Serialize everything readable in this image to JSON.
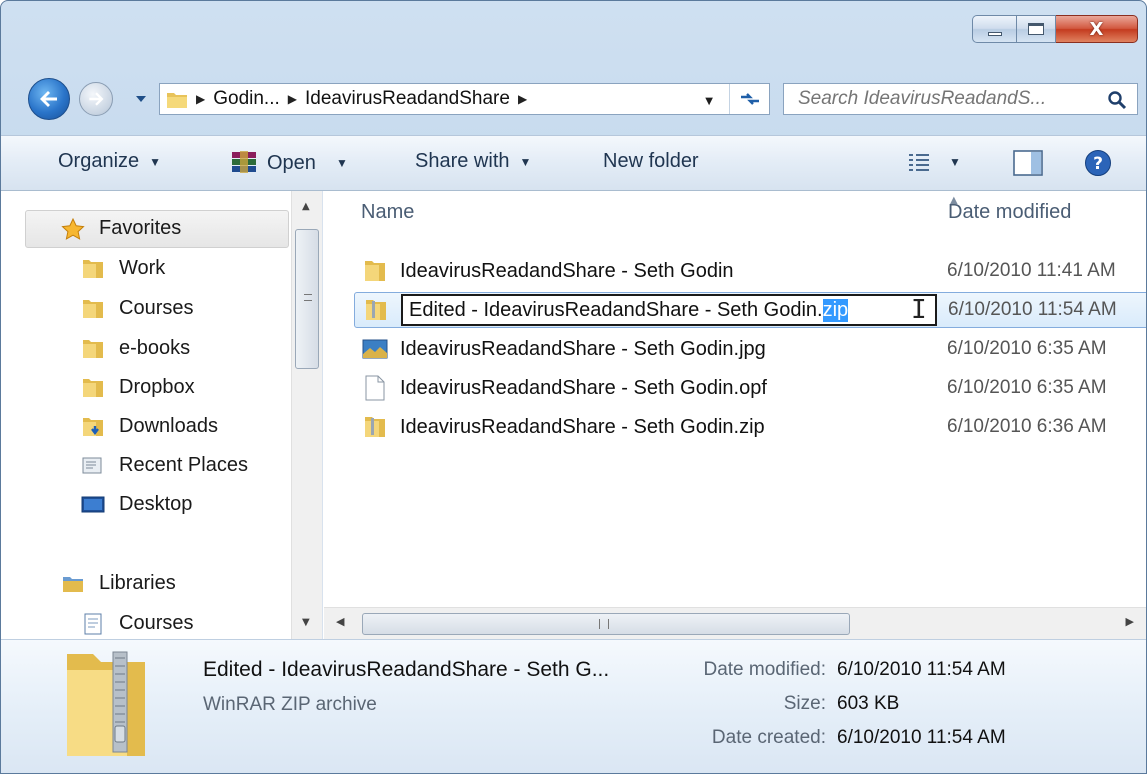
{
  "window": {
    "close_glyph": "X"
  },
  "address_bar": {
    "crumbs": [
      "Godin...",
      "IdeavirusReadandShare"
    ]
  },
  "search": {
    "placeholder": "Search IdeavirusReadandS..."
  },
  "toolbar": {
    "organize": "Organize",
    "open": "Open",
    "share_with": "Share with",
    "new_folder": "New folder"
  },
  "nav_pane": {
    "favorites": "Favorites",
    "items": [
      "Work",
      "Courses",
      "e-books",
      "Dropbox",
      "Downloads",
      "Recent Places",
      "Desktop"
    ],
    "libraries": "Libraries",
    "library_items": [
      "Courses"
    ]
  },
  "file_list": {
    "columns": {
      "name": "Name",
      "date_modified": "Date modified"
    },
    "rows": [
      {
        "name": "IdeavirusReadandShare - Seth Godin",
        "date": "6/10/2010 11:41 AM",
        "icon": "folder-icon"
      },
      {
        "name": "Edited - IdeavirusReadandShare - Seth Godin.",
        "name_selected": "zip",
        "date": "6/10/2010 11:54 AM",
        "icon": "zip-archive-icon",
        "renaming": true
      },
      {
        "name": "IdeavirusReadandShare - Seth Godin.jpg",
        "date": "6/10/2010 6:35 AM",
        "icon": "image-file-icon"
      },
      {
        "name": "IdeavirusReadandShare - Seth Godin.opf",
        "date": "6/10/2010 6:35 AM",
        "icon": "blank-file-icon"
      },
      {
        "name": "IdeavirusReadandShare - Seth Godin.zip",
        "date": "6/10/2010 6:36 AM",
        "icon": "zip-archive-icon"
      }
    ]
  },
  "details": {
    "title": "Edited - IdeavirusReadandShare - Seth G...",
    "type": "WinRAR ZIP archive",
    "date_modified_label": "Date modified:",
    "date_modified": "6/10/2010 11:54 AM",
    "size_label": "Size:",
    "size": "603 KB",
    "date_created_label": "Date created:",
    "date_created": "6/10/2010 11:54 AM"
  },
  "colors": {
    "selection": "#3399ff",
    "chrome": "#bcd3ea",
    "close_button": "#c43b1f"
  }
}
